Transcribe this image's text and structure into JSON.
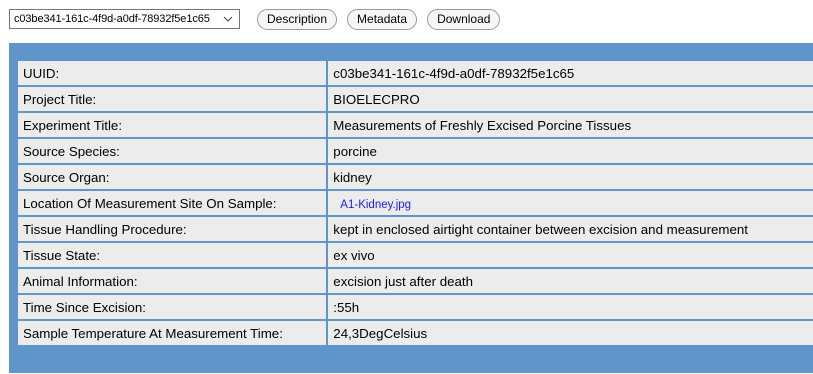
{
  "toolbar": {
    "selected_record": "c03be341-161c-4f9d-a0df-78932f5e1c65",
    "description_label": "Description",
    "metadata_label": "Metadata",
    "download_label": "Download"
  },
  "metadata": {
    "rows": [
      {
        "key": "UUID:",
        "value": "c03be341-161c-4f9d-a0df-78932f5e1c65"
      },
      {
        "key": "Project Title:",
        "value": "BIOELECPRO"
      },
      {
        "key": "Experiment Title:",
        "value": "Measurements of Freshly Excised Porcine Tissues"
      },
      {
        "key": "Source Species:",
        "value": "porcine"
      },
      {
        "key": "Source Organ:",
        "value": "kidney"
      },
      {
        "key": "Location Of Measurement Site On Sample:",
        "value": "A1-Kidney.jpg"
      },
      {
        "key": "Tissue Handling Procedure:",
        "value": "kept in enclosed airtight container between excision and measurement"
      },
      {
        "key": "Tissue State:",
        "value": "ex vivo"
      },
      {
        "key": "Animal Information:",
        "value": "excision just after death"
      },
      {
        "key": "Time Since Excision:",
        "value": ":55h"
      },
      {
        "key": "Sample Temperature At Measurement Time:",
        "value": "24,3DegCelsius"
      }
    ]
  },
  "colors": {
    "panel_background": "#5f95cb",
    "cell_background": "#ececec",
    "link_color": "#1a1aff"
  }
}
